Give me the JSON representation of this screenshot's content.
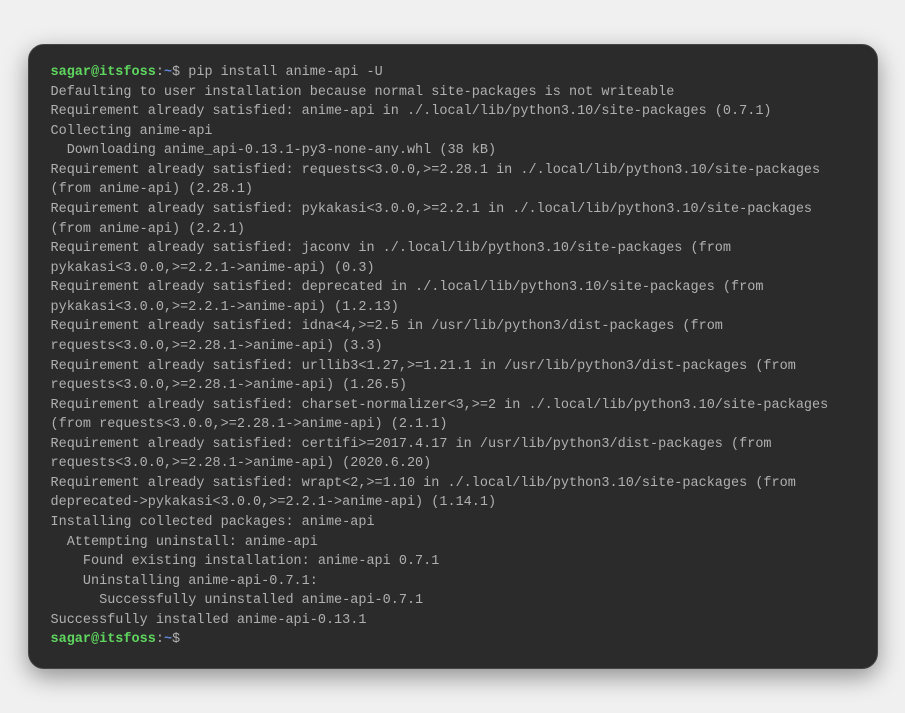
{
  "prompt": {
    "user_host": "sagar@itsfoss",
    "colon": ":",
    "path": "~",
    "dollar": "$ "
  },
  "command1": "pip install anime-api -U",
  "output": {
    "line1": "Defaulting to user installation because normal site-packages is not writeable",
    "line2": "Requirement already satisfied: anime-api in ./.local/lib/python3.10/site-packages (0.7.1)",
    "line3": "Collecting anime-api",
    "line4": "  Downloading anime_api-0.13.1-py3-none-any.whl (38 kB)",
    "line5": "Requirement already satisfied: requests<3.0.0,>=2.28.1 in ./.local/lib/python3.10/site-packages (from anime-api) (2.28.1)",
    "line6": "Requirement already satisfied: pykakasi<3.0.0,>=2.2.1 in ./.local/lib/python3.10/site-packages (from anime-api) (2.2.1)",
    "line7": "Requirement already satisfied: jaconv in ./.local/lib/python3.10/site-packages (from pykakasi<3.0.0,>=2.2.1->anime-api) (0.3)",
    "line8": "Requirement already satisfied: deprecated in ./.local/lib/python3.10/site-packages (from pykakasi<3.0.0,>=2.2.1->anime-api) (1.2.13)",
    "line9": "Requirement already satisfied: idna<4,>=2.5 in /usr/lib/python3/dist-packages (from requests<3.0.0,>=2.28.1->anime-api) (3.3)",
    "line10": "Requirement already satisfied: urllib3<1.27,>=1.21.1 in /usr/lib/python3/dist-packages (from requests<3.0.0,>=2.28.1->anime-api) (1.26.5)",
    "line11": "Requirement already satisfied: charset-normalizer<3,>=2 in ./.local/lib/python3.10/site-packages (from requests<3.0.0,>=2.28.1->anime-api) (2.1.1)",
    "line12": "Requirement already satisfied: certifi>=2017.4.17 in /usr/lib/python3/dist-packages (from requests<3.0.0,>=2.28.1->anime-api) (2020.6.20)",
    "line13": "Requirement already satisfied: wrapt<2,>=1.10 in ./.local/lib/python3.10/site-packages (from deprecated->pykakasi<3.0.0,>=2.2.1->anime-api) (1.14.1)",
    "line14": "Installing collected packages: anime-api",
    "line15": "  Attempting uninstall: anime-api",
    "line16": "    Found existing installation: anime-api 0.7.1",
    "line17": "    Uninstalling anime-api-0.7.1:",
    "line18": "      Successfully uninstalled anime-api-0.7.1",
    "line19": "Successfully installed anime-api-0.13.1"
  }
}
